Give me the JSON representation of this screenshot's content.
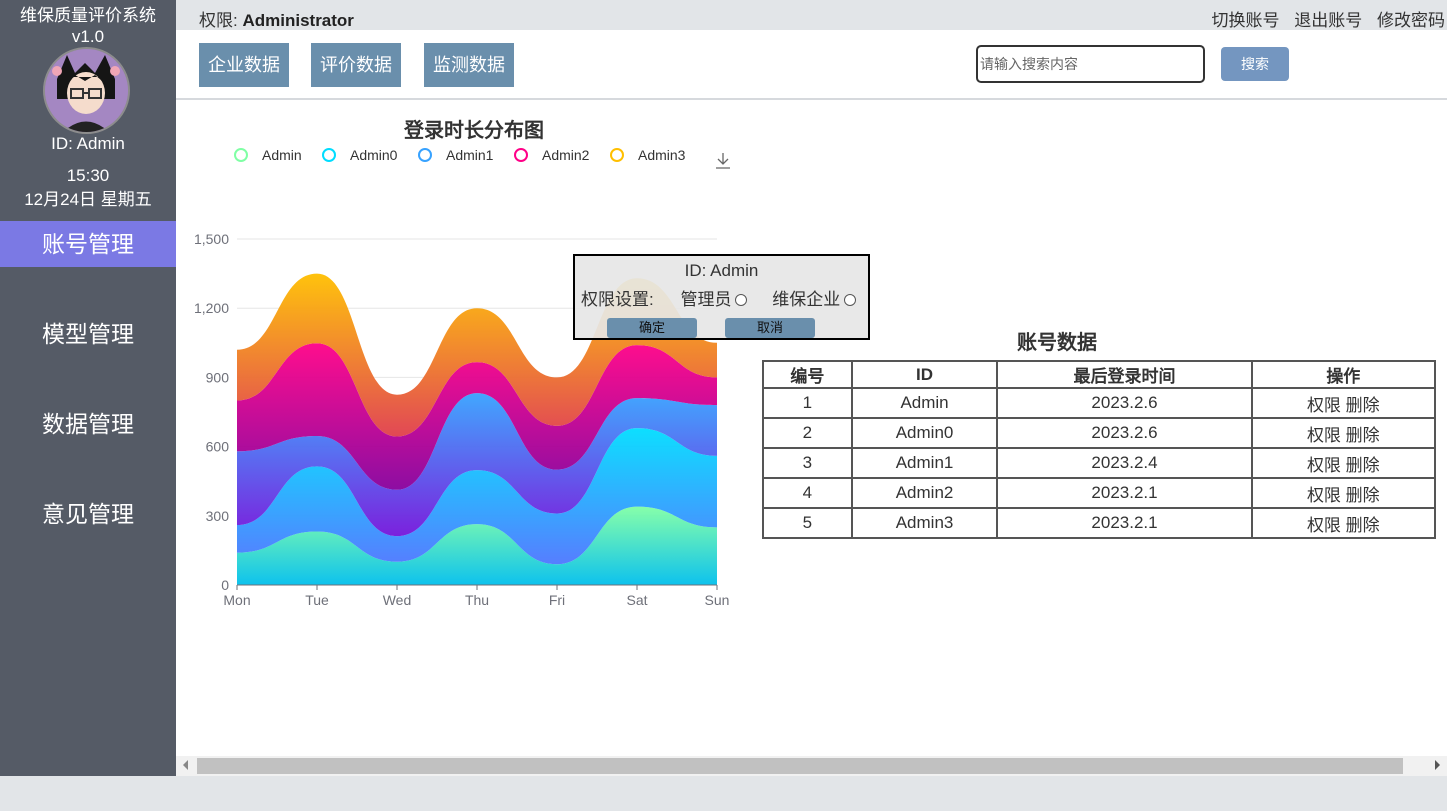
{
  "app": {
    "title": "维保质量评价系统",
    "version": "v1.0"
  },
  "user": {
    "id_label": "ID: Admin"
  },
  "clock": {
    "time": "15:30",
    "date": "12月24日 星期五"
  },
  "nav": [
    {
      "label": "账号管理",
      "active": true
    },
    {
      "label": "模型管理",
      "active": false
    },
    {
      "label": "数据管理",
      "active": false
    },
    {
      "label": "意见管理",
      "active": false
    }
  ],
  "topbar": {
    "perm_prefix": "权限:",
    "perm_value": "Administrator",
    "links": [
      "切换账号",
      "退出账号",
      "修改密码"
    ]
  },
  "toolbar": {
    "buttons": [
      "企业数据",
      "评价数据",
      "监测数据"
    ],
    "search_placeholder": "请输入搜索内容",
    "search_label": "搜索"
  },
  "chart_data": {
    "type": "area",
    "title": "登录时长分布图",
    "categories": [
      "Mon",
      "Tue",
      "Wed",
      "Thu",
      "Fri",
      "Sat",
      "Sun"
    ],
    "ylim": [
      0,
      1500
    ],
    "yticks": [
      0,
      300,
      600,
      900,
      1200,
      1500
    ],
    "stacked": true,
    "smooth": true,
    "legend_position": "top",
    "series": [
      {
        "name": "Admin",
        "values": [
          140,
          232,
          101,
          264,
          90,
          340,
          250
        ],
        "color": "#80ffa5"
      },
      {
        "name": "Admin0",
        "values": [
          120,
          282,
          111,
          234,
          220,
          340,
          310
        ],
        "color": "#00ddff"
      },
      {
        "name": "Admin1",
        "values": [
          320,
          132,
          201,
          334,
          190,
          130,
          220
        ],
        "color": "#37a2ff"
      },
      {
        "name": "Admin2",
        "values": [
          220,
          402,
          231,
          134,
          190,
          230,
          120
        ],
        "color": "#ff0087"
      },
      {
        "name": "Admin3",
        "values": [
          220,
          302,
          181,
          234,
          210,
          290,
          150
        ],
        "color": "#ffbf00"
      }
    ]
  },
  "popup": {
    "id_label": "ID: Admin",
    "perm_label": "权限设置:",
    "option1": "管理员",
    "option2": "维保企业",
    "confirm": "确定",
    "cancel": "取消"
  },
  "table": {
    "title": "账号数据",
    "headers": [
      "编号",
      "ID",
      "最后登录时间",
      "操作"
    ],
    "rows": [
      {
        "no": "1",
        "id": "Admin",
        "last_login": "2023.2.6",
        "op1": "权限",
        "op2": "删除"
      },
      {
        "no": "2",
        "id": "Admin0",
        "last_login": "2023.2.6",
        "op1": "权限",
        "op2": "删除"
      },
      {
        "no": "3",
        "id": "Admin1",
        "last_login": "2023.2.4",
        "op1": "权限",
        "op2": "删除"
      },
      {
        "no": "4",
        "id": "Admin2",
        "last_login": "2023.2.1",
        "op1": "权限",
        "op2": "删除"
      },
      {
        "no": "5",
        "id": "Admin3",
        "last_login": "2023.2.1",
        "op1": "权限",
        "op2": "删除"
      }
    ]
  }
}
